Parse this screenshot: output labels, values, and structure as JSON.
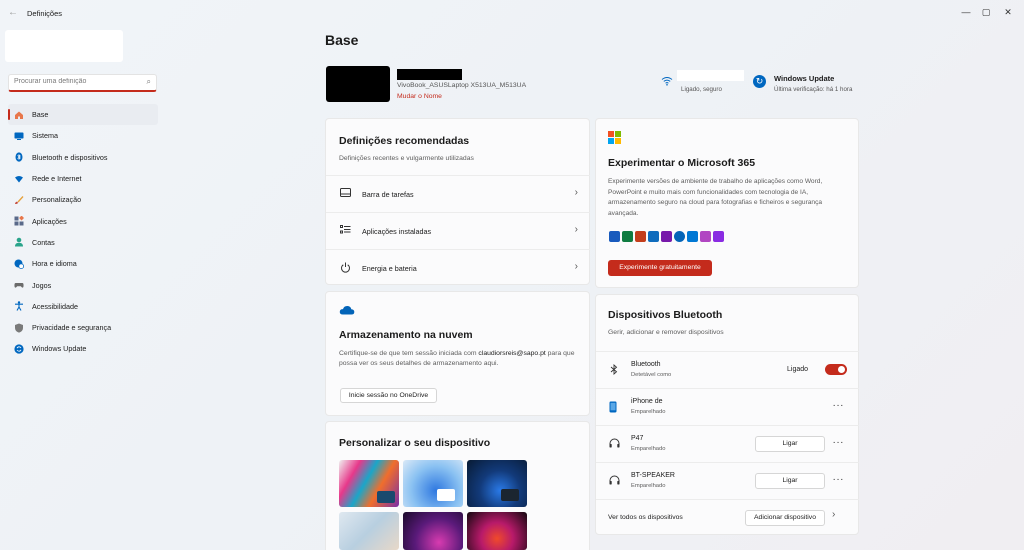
{
  "window": {
    "title": "Definições",
    "back": "←",
    "minimize": "—",
    "maximize": "▢",
    "close": "✕"
  },
  "search": {
    "placeholder": "Procurar uma definição"
  },
  "sidebar": {
    "items": [
      {
        "label": "Base",
        "icon": "home-icon",
        "color": "#e8774b",
        "active": true
      },
      {
        "label": "Sistema",
        "icon": "monitor-icon",
        "color": "#0067c0"
      },
      {
        "label": "Bluetooth e dispositivos",
        "icon": "bluetooth-icon",
        "color": "#0067c0"
      },
      {
        "label": "Rede e Internet",
        "icon": "wifi-icon",
        "color": "#0067c0"
      },
      {
        "label": "Personalização",
        "icon": "brush-icon",
        "color": "#e6a23c"
      },
      {
        "label": "Aplicações",
        "icon": "apps-icon",
        "color": "#5a6a8a"
      },
      {
        "label": "Contas",
        "icon": "person-icon",
        "color": "#2aa48b"
      },
      {
        "label": "Hora e idioma",
        "icon": "globe-clock-icon",
        "color": "#0067c0"
      },
      {
        "label": "Jogos",
        "icon": "gamepad-icon",
        "color": "#6b6b6b"
      },
      {
        "label": "Acessibilidade",
        "icon": "accessibility-icon",
        "color": "#0067c0"
      },
      {
        "label": "Privacidade e segurança",
        "icon": "shield-icon",
        "color": "#7a7a7a"
      },
      {
        "label": "Windows Update",
        "icon": "update-icon",
        "color": "#0067c0"
      }
    ]
  },
  "main": {
    "title": "Base",
    "device": {
      "model": "VivoBook_ASUSLaptop X513UA_M513UA",
      "rename": "Mudar o Nome"
    },
    "network": {
      "status": "Ligado, seguro"
    },
    "update": {
      "title": "Windows Update",
      "subtitle": "Última verificação: há 1 hora"
    }
  },
  "recommended": {
    "title": "Definições recomendadas",
    "subtitle": "Definições recentes e vulgarmente utilizadas",
    "items": [
      {
        "label": "Barra de tarefas",
        "icon": "taskbar-icon"
      },
      {
        "label": "Aplicações instaladas",
        "icon": "list-icon"
      },
      {
        "label": "Energia e bateria",
        "icon": "power-icon"
      }
    ]
  },
  "cloud": {
    "title": "Armazenamento na nuvem",
    "text_before": "Certifique-se de que tem sessão iniciada com ",
    "email": "claudiorsreis@sapo.pt",
    "text_after": "para que possa ver os seus detalhes de armazenamento aqui.",
    "button": "Inicie sessão no OneDrive"
  },
  "personalize": {
    "title": "Personalizar o seu dispositivo"
  },
  "m365": {
    "title": "Experimentar o Microsoft 365",
    "description": "Experimente versões de ambiente de trabalho de aplicações como Word, PowerPoint e muito mais com funcionalidades com tecnologia de IA, armazenamento seguro na cloud para fotografias e ficheiros e segurança avançada.",
    "button": "Experimente gratuitamente",
    "logo_colors": [
      "#f25022",
      "#7fba00",
      "#00a4ef",
      "#ffb900"
    ],
    "app_colors": [
      "#185abd",
      "#107c41",
      "#c43e1c",
      "#0f6cbd",
      "#7719aa",
      "#0364b8",
      "#0078d4",
      "#b146c2",
      "#8a2be2"
    ]
  },
  "bluetooth": {
    "title": "Dispositivos Bluetooth",
    "subtitle": "Gerir, adicionar e remover dispositivos",
    "bt_row": {
      "name": "Bluetooth",
      "status": "Detetável como",
      "toggle_label": "Ligado"
    },
    "devices": [
      {
        "name": "iPhone de",
        "status": "Emparelhado",
        "icon": "phone-icon",
        "button": ""
      },
      {
        "name": "P47",
        "status": "Emparelhado",
        "icon": "headphones-icon",
        "button": "Ligar"
      },
      {
        "name": "BT-SPEAKER",
        "status": "Emparelhado",
        "icon": "headphones-icon",
        "button": "Ligar"
      }
    ],
    "footer_label": "Ver todos os dispositivos",
    "add_button": "Adicionar dispositivo"
  },
  "colors": {
    "accent": "#c42b1c",
    "brand_blue": "#0067c0"
  }
}
